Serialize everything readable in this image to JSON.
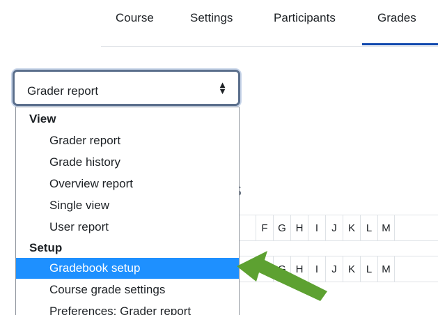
{
  "nav": {
    "tabs": [
      {
        "label": "Course"
      },
      {
        "label": "Settings"
      },
      {
        "label": "Participants"
      },
      {
        "label": "Grades",
        "active": true
      }
    ]
  },
  "select": {
    "selected_label": "Grader report"
  },
  "dropdown": {
    "groups": [
      {
        "label": "View",
        "options": [
          "Grader report",
          "Grade history",
          "Overview report",
          "Single view",
          "User report"
        ]
      },
      {
        "label": "Setup",
        "options": [
          "Gradebook setup",
          "Course grade settings",
          "Preferences: Grader report"
        ]
      }
    ],
    "highlighted_option": "Gradebook setup"
  },
  "background": {
    "partial_heading_letter": "s",
    "letter_filter_row_1": [
      "F",
      "G",
      "H",
      "I",
      "J",
      "K",
      "L",
      "M"
    ],
    "letter_filter_row_2": [
      "F",
      "G",
      "H",
      "I",
      "J",
      "K",
      "L",
      "M"
    ]
  },
  "colors": {
    "highlight": "#1e90ff",
    "arrow": "#5da131",
    "active_tab_underline": "#0f47ad"
  }
}
